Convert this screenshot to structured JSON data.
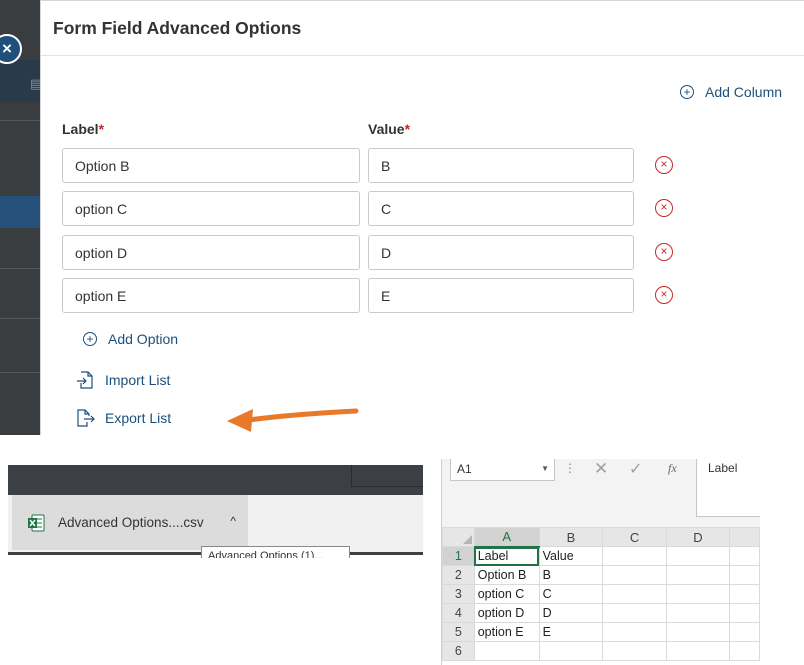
{
  "dialog": {
    "title": "Form Field Advanced Options",
    "add_column_label": "Add Column",
    "label_header": "Label",
    "value_header": "Value",
    "required_marker": "*",
    "options": [
      {
        "label": "Option B",
        "value": "B"
      },
      {
        "label": "option C",
        "value": "C"
      },
      {
        "label": "option D",
        "value": "D"
      },
      {
        "label": "option E",
        "value": "E"
      }
    ],
    "add_option_label": "Add Option",
    "import_list_label": "Import List",
    "export_list_label": "Export List",
    "close_icon": "×",
    "remove_icon": "×"
  },
  "download_bar": {
    "file_name": "Advanced Options....csv",
    "tooltip": "Advanced Options (1)...",
    "chevron": "^"
  },
  "spreadsheet": {
    "name_box": "A1",
    "formula_value": "Label",
    "column_headers": [
      "A",
      "B",
      "C",
      "D"
    ],
    "rows": [
      {
        "num": "1",
        "cells": [
          "Label",
          "Value",
          "",
          ""
        ]
      },
      {
        "num": "2",
        "cells": [
          "Option B",
          "B",
          "",
          ""
        ]
      },
      {
        "num": "3",
        "cells": [
          "option C",
          "C",
          "",
          ""
        ]
      },
      {
        "num": "4",
        "cells": [
          "option D",
          "D",
          "",
          ""
        ]
      },
      {
        "num": "5",
        "cells": [
          "option E",
          "E",
          "",
          ""
        ]
      },
      {
        "num": "6",
        "cells": [
          "",
          "",
          "",
          ""
        ]
      }
    ]
  },
  "colors": {
    "link": "#1d4f7c",
    "remove": "#c62828",
    "arrow": "#e8782a",
    "excel_green": "#217346"
  }
}
